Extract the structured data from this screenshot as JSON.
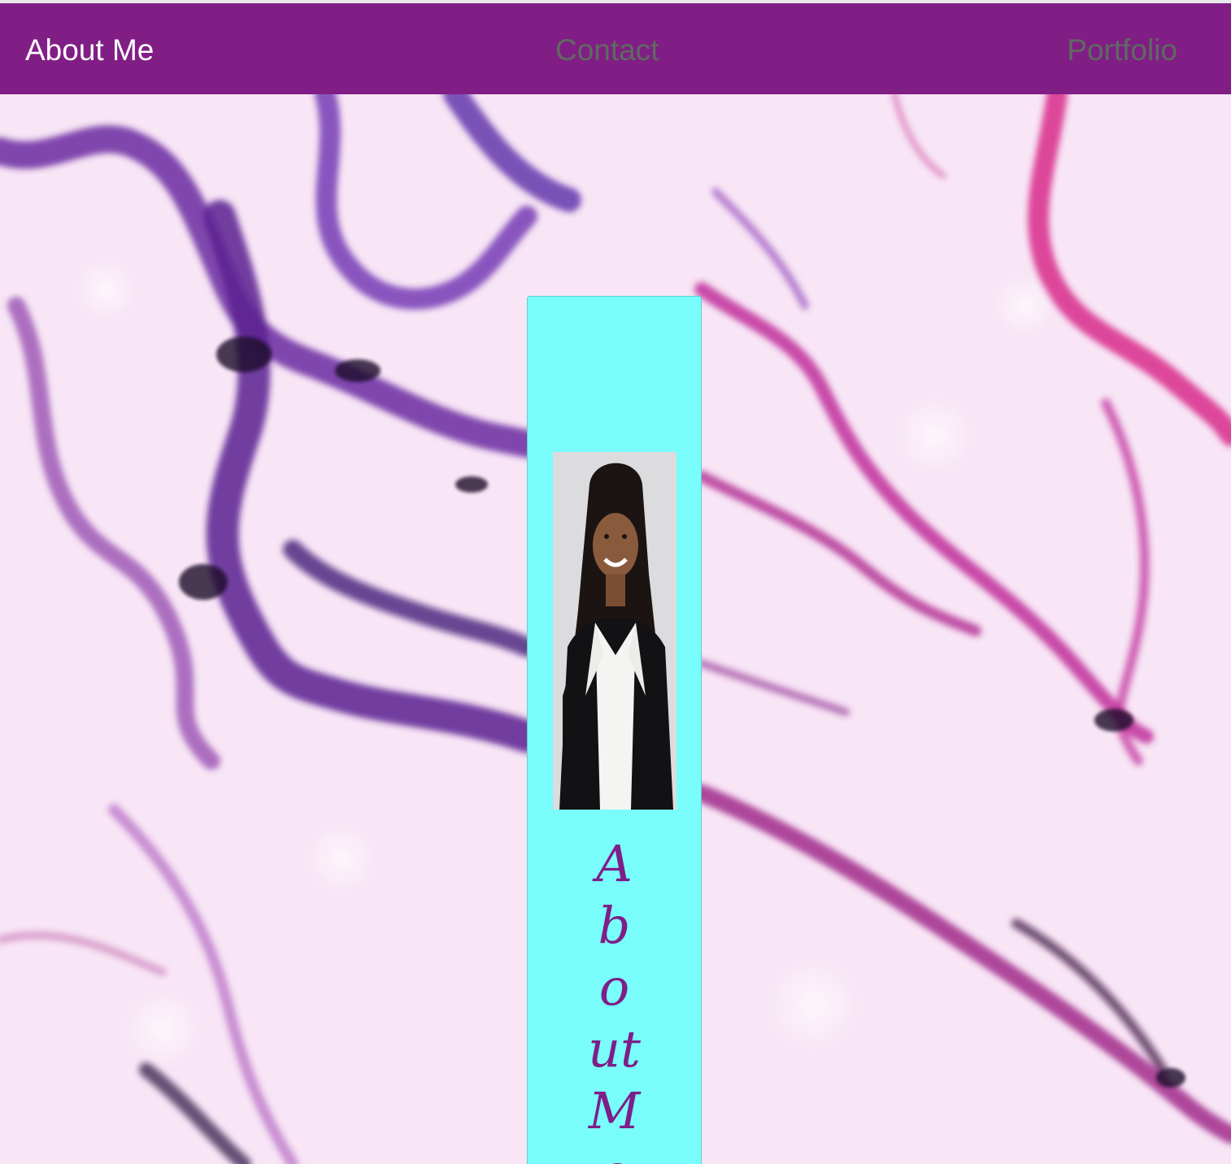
{
  "navbar": {
    "brand": "About Me",
    "links": [
      {
        "label": "Contact"
      },
      {
        "label": "Portfolio"
      }
    ],
    "background_color": "#811e85",
    "brand_color": "#ffffff",
    "link_color": "#5e6a5f"
  },
  "hero": {
    "background": "pink-purple-marble-texture"
  },
  "card": {
    "background_color": "#78fdfb",
    "image": "profile-photo",
    "title": "About Me",
    "title_color": "#7e1e87"
  }
}
